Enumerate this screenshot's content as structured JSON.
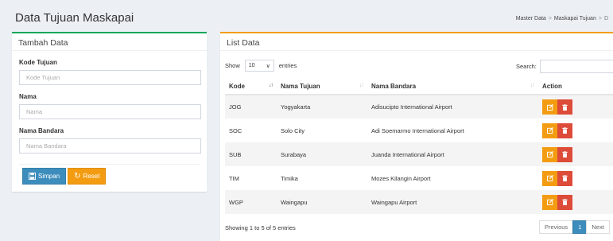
{
  "header": {
    "title": "Data Tujuan Maskapai",
    "breadcrumb": [
      "Master Data",
      "Maskapai Tujuan",
      "D"
    ]
  },
  "form": {
    "title": "Tambah Data",
    "fields": [
      {
        "label": "Kode Tujuan",
        "placeholder": "Kode Tujuan",
        "value": ""
      },
      {
        "label": "Nama",
        "placeholder": "Nama",
        "value": ""
      },
      {
        "label": "Nama Bandara",
        "placeholder": "Nama Bandara",
        "value": ""
      }
    ],
    "save_label": "Simpan",
    "reset_label": "Reset"
  },
  "list": {
    "title": "List Data",
    "show_label": "Show",
    "entries_value": "10",
    "entries_label": "entries",
    "search_label": "Search:",
    "columns": [
      "Kode",
      "Nama Tujuan",
      "Nama Bandara",
      "Action"
    ],
    "rows": [
      {
        "kode": "JOG",
        "nama": "Yogyakarta",
        "bandara": "Adisucipto International Airport"
      },
      {
        "kode": "SOC",
        "nama": "Solo City",
        "bandara": "Adi Soemarmo International Airport"
      },
      {
        "kode": "SUB",
        "nama": "Surabaya",
        "bandara": "Juanda International Airport"
      },
      {
        "kode": "TIM",
        "nama": "Timika",
        "bandara": "Mozes Kilangin Airport"
      },
      {
        "kode": "WGP",
        "nama": "Waingapu",
        "bandara": "Waingapu Airport"
      }
    ],
    "info": "Showing 1 to 5 of 5 entries",
    "pagination": {
      "previous": "Previous",
      "current": "1",
      "next": "Next"
    }
  },
  "colors": {
    "primary": "#3c8dbc",
    "warning": "#f39c12",
    "danger": "#dd4b39",
    "success": "#00a65a"
  }
}
